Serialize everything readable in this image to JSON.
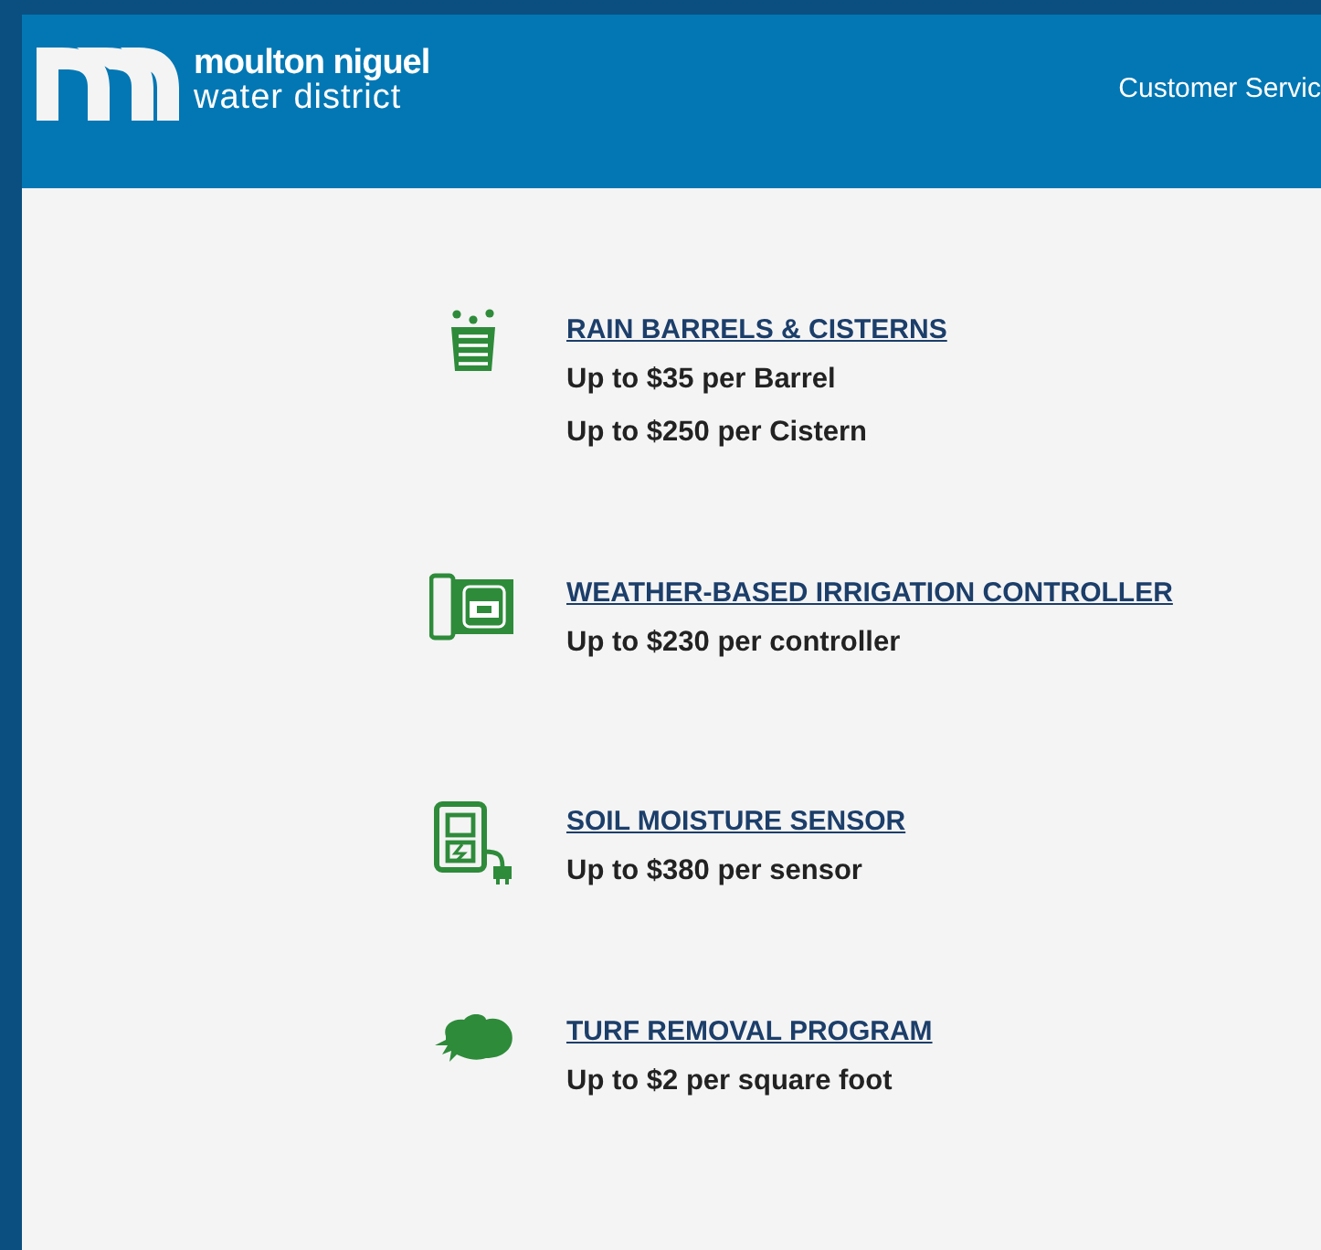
{
  "header": {
    "logo_line_1": "moulton niguel",
    "logo_line_2": "water district",
    "nav": [
      {
        "label": "Customer Servic"
      }
    ]
  },
  "programs": [
    {
      "kind": "barrel",
      "title": "RAIN BARRELS & CISTERNS",
      "lines": [
        "Up to $35 per Barrel",
        "Up to $250 per Cistern"
      ]
    },
    {
      "kind": "controller",
      "title": "WEATHER-BASED IRRIGATION CONTROLLER",
      "lines": [
        "Up to $230 per controller"
      ]
    },
    {
      "kind": "sensor",
      "title": "SOIL MOISTURE SENSOR",
      "lines": [
        "Up to $380 per sensor"
      ]
    },
    {
      "kind": "turf",
      "title": "TURF REMOVAL PROGRAM",
      "lines": [
        "Up to $2 per square foot"
      ]
    }
  ]
}
